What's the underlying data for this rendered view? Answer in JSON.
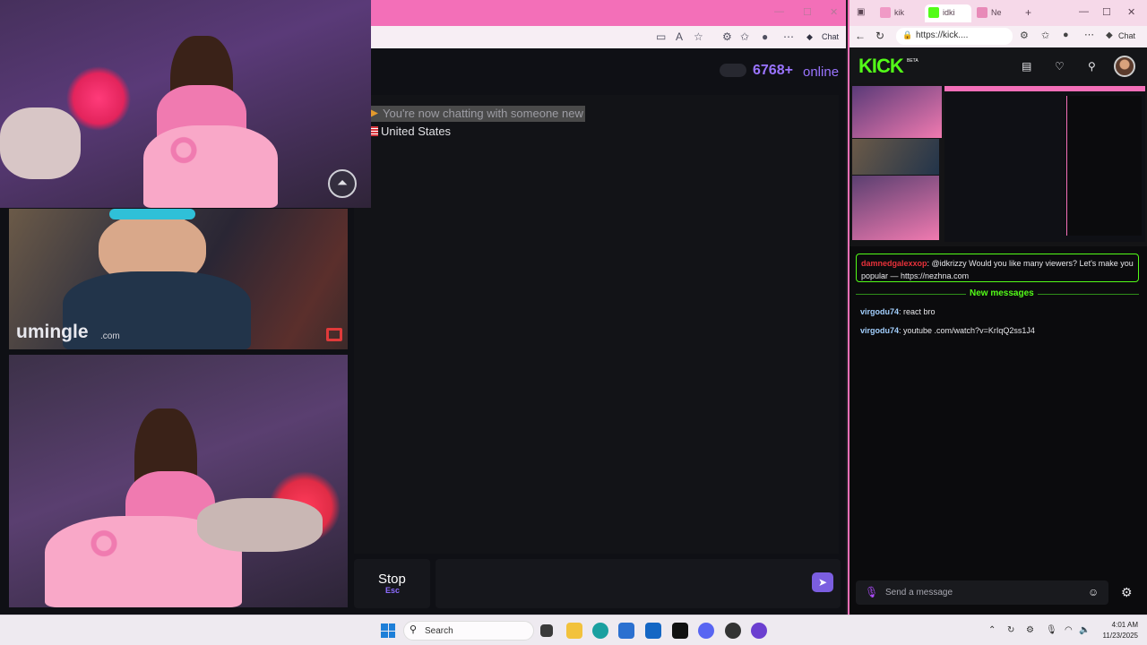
{
  "left_browser": {
    "chat_button": "Chat",
    "window_controls": {
      "minimize": "—",
      "maximize": "☐",
      "close": "✕"
    }
  },
  "umingle": {
    "online_count": "6768+",
    "online_label": "online",
    "status_message": "You're now chatting with someone new",
    "partner_country": "United States",
    "logo": "umingle",
    "logo_suffix": ".com",
    "stop_label": "Stop",
    "stop_key": "Esc",
    "send_icon": "send-arrow-icon"
  },
  "right_browser": {
    "tabs": [
      {
        "label": "kik",
        "color": "#f09ac6"
      },
      {
        "label": "idki",
        "color": "#53fc18"
      },
      {
        "label": "Ne",
        "color": "#e88ab8"
      }
    ],
    "url": "https://kick....",
    "chat_button": "Chat"
  },
  "kick": {
    "logo": "KICK",
    "beta": "BETA",
    "pinned": {
      "user": "damnedgalexxop",
      "text": ": @idkrizzy Would you like many viewers? Let's make you popular — https://nezhna.com"
    },
    "new_messages": "New messages",
    "messages": [
      {
        "user": "virgodu74",
        "text": ": react bro"
      },
      {
        "user": "virgodu74",
        "text": ": youtube .com/watch?v=KrIqQ2ss1J4"
      }
    ],
    "input_placeholder": "Send a message",
    "colors": {
      "brand": "#53fc18",
      "pinned_user": "#e8313a",
      "chat_user": "#a3d0ff"
    }
  },
  "taskbar": {
    "search_placeholder": "Search",
    "time": "4:01 AM",
    "date": "11/23/2025"
  }
}
